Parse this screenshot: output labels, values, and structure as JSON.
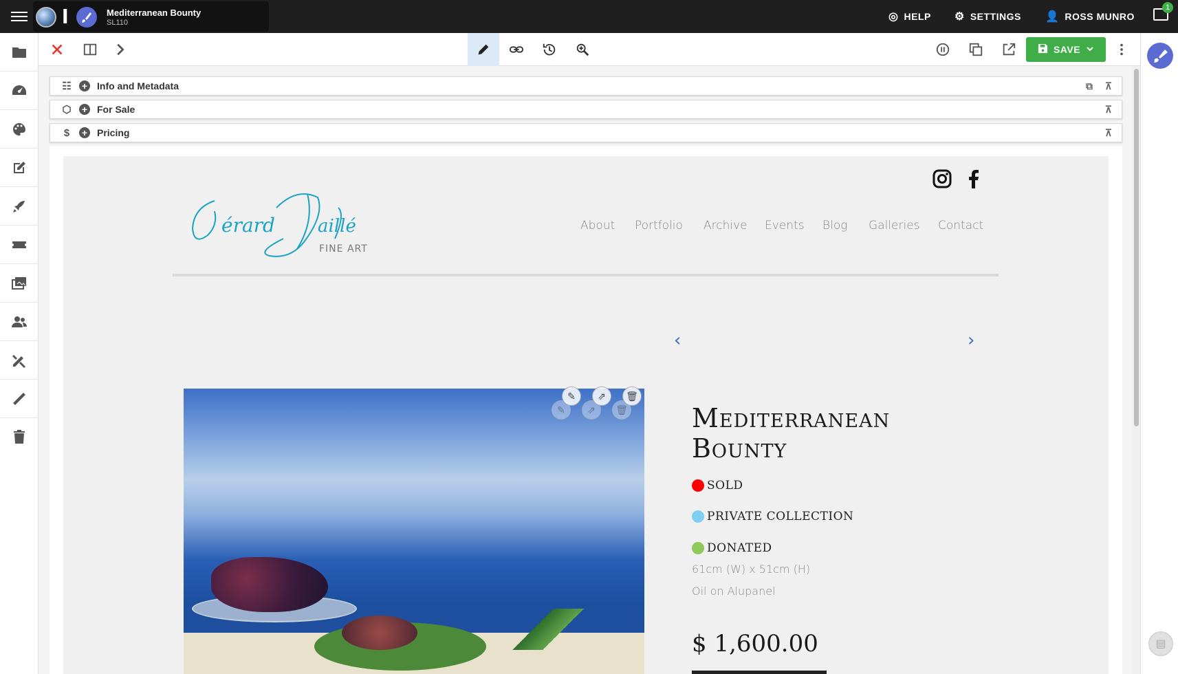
{
  "topbar": {
    "doc_title": "Mediterranean Bounty",
    "doc_code": "SL110",
    "help": "HELP",
    "settings": "SETTINGS",
    "user": "ROSS MUNRO",
    "notifications": "1"
  },
  "toolbar": {
    "save_label": "SAVE"
  },
  "sections": [
    {
      "label": "Info and Metadata",
      "icon": "list-icon"
    },
    {
      "label": "For Sale",
      "icon": "box-icon"
    },
    {
      "label": "Pricing",
      "icon": "dollar-icon"
    }
  ],
  "site": {
    "logo_script": "Gérard Maillé",
    "logo_sub": "FINE ART",
    "nav": [
      "About",
      "Portfolio",
      "Archive",
      "Events",
      "Blog",
      "Galleries",
      "Contact"
    ],
    "social": [
      "instagram-icon",
      "facebook-icon"
    ]
  },
  "artwork": {
    "title_line1": "Mediterranean",
    "title_line2": "Bounty",
    "statuses": [
      {
        "label": "SOLD",
        "color": "#ff0000"
      },
      {
        "label": "PRIVATE COLLECTION",
        "color": "#7fd0f0"
      },
      {
        "label": "DONATED",
        "color": "#8fc95a"
      }
    ],
    "dimensions": "61cm (W) x 51cm (H)",
    "medium": "Oil on Alupanel",
    "price": "$ 1,600.00"
  },
  "colors": {
    "accent": "#3fae49",
    "logo": "#1ba3c4",
    "brand": "#5b6bd1"
  }
}
